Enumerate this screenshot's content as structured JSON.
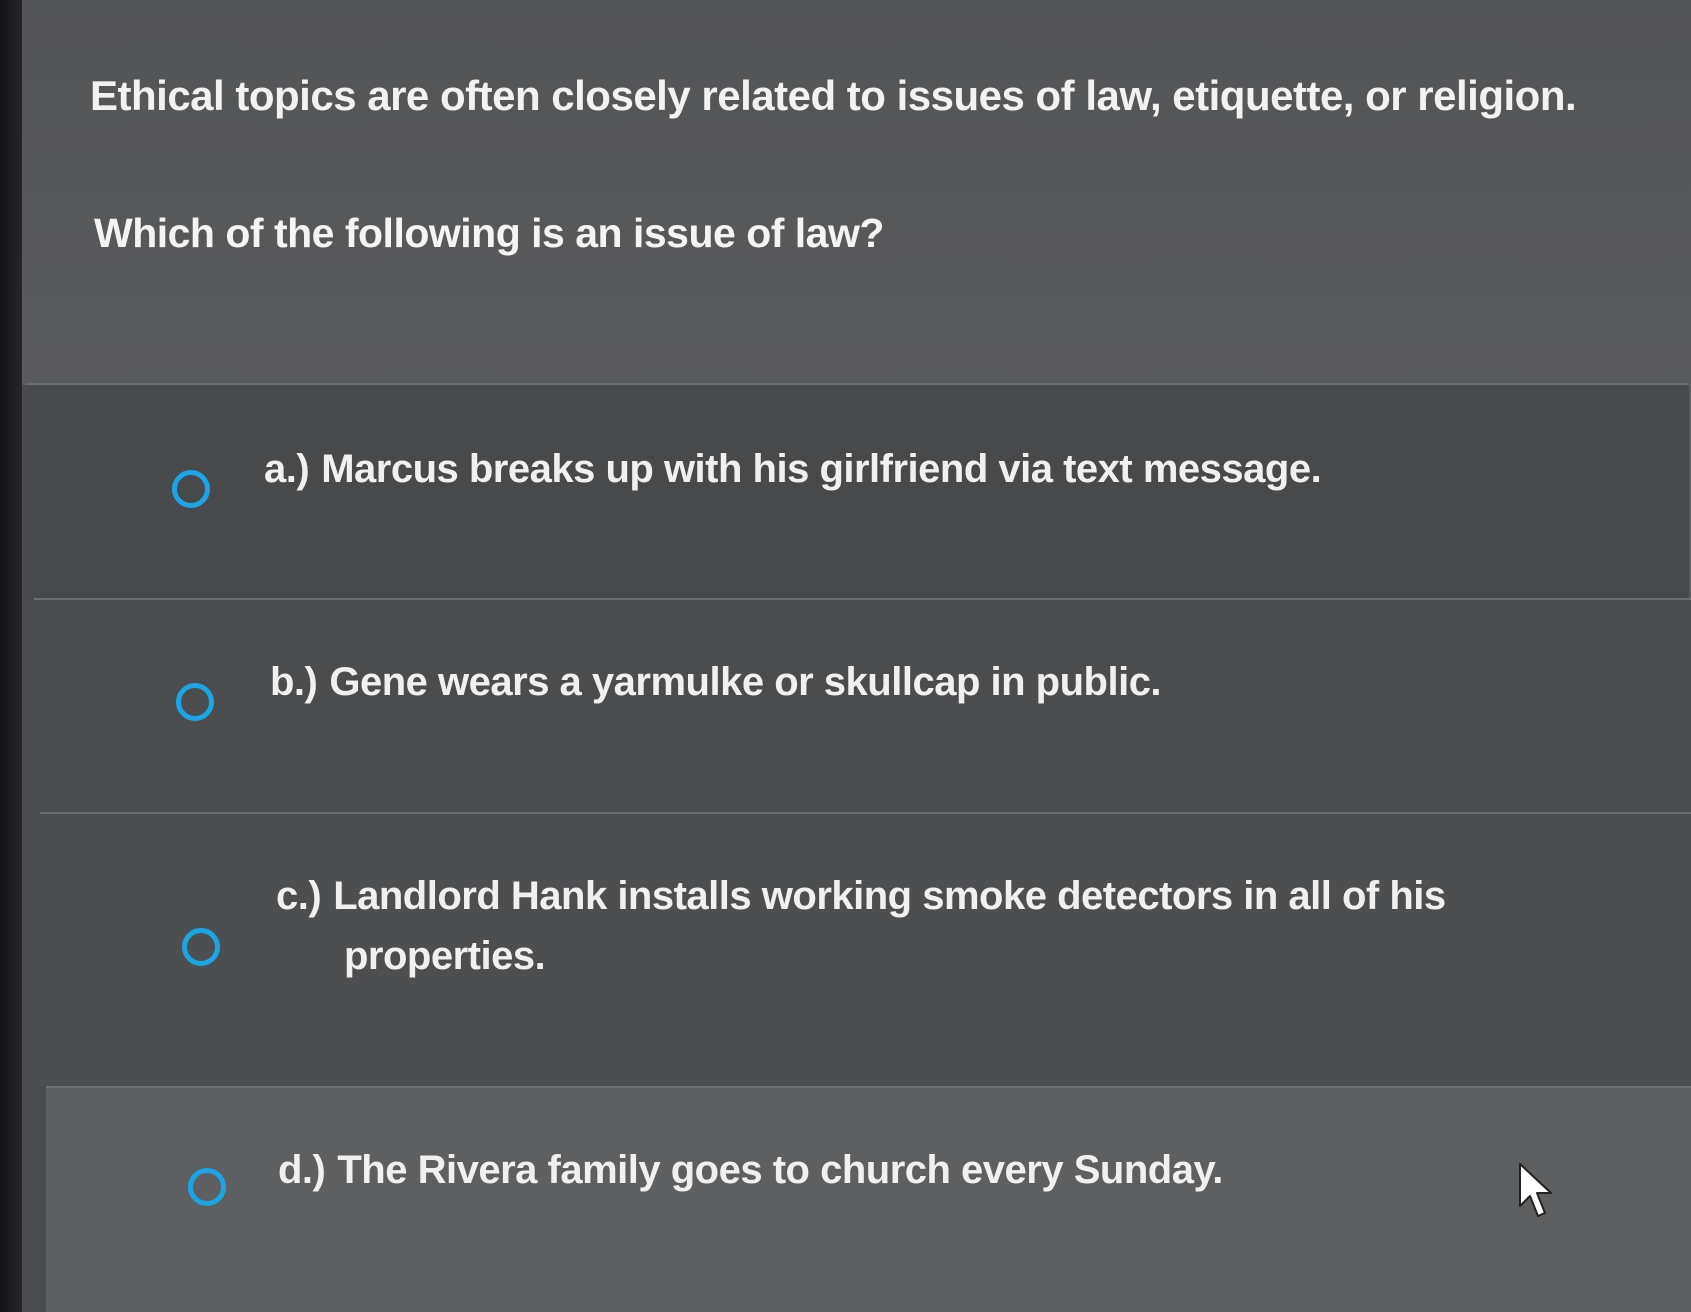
{
  "question": {
    "stem": "Ethical topics are often closely related to issues of law, etiquette, or religion.",
    "prompt": "Which of the following is an issue of law?"
  },
  "options": [
    {
      "letter": "a.)",
      "text": "Marcus breaks up with his girlfriend via text message."
    },
    {
      "letter": "b.)",
      "text": "Gene wears a yarmulke or skullcap in public."
    },
    {
      "letter": "c.)",
      "text_line1": "Landlord Hank installs working smoke detectors in all of his",
      "text_line2": "properties."
    },
    {
      "letter": "d.)",
      "text": "The Rivera family goes to church every Sunday."
    }
  ],
  "colors": {
    "radio_accent": "#1aa6e6",
    "text": "#f0f0f0"
  },
  "icons": {
    "radio": "radio-unselected-icon",
    "cursor": "mouse-pointer-icon"
  }
}
